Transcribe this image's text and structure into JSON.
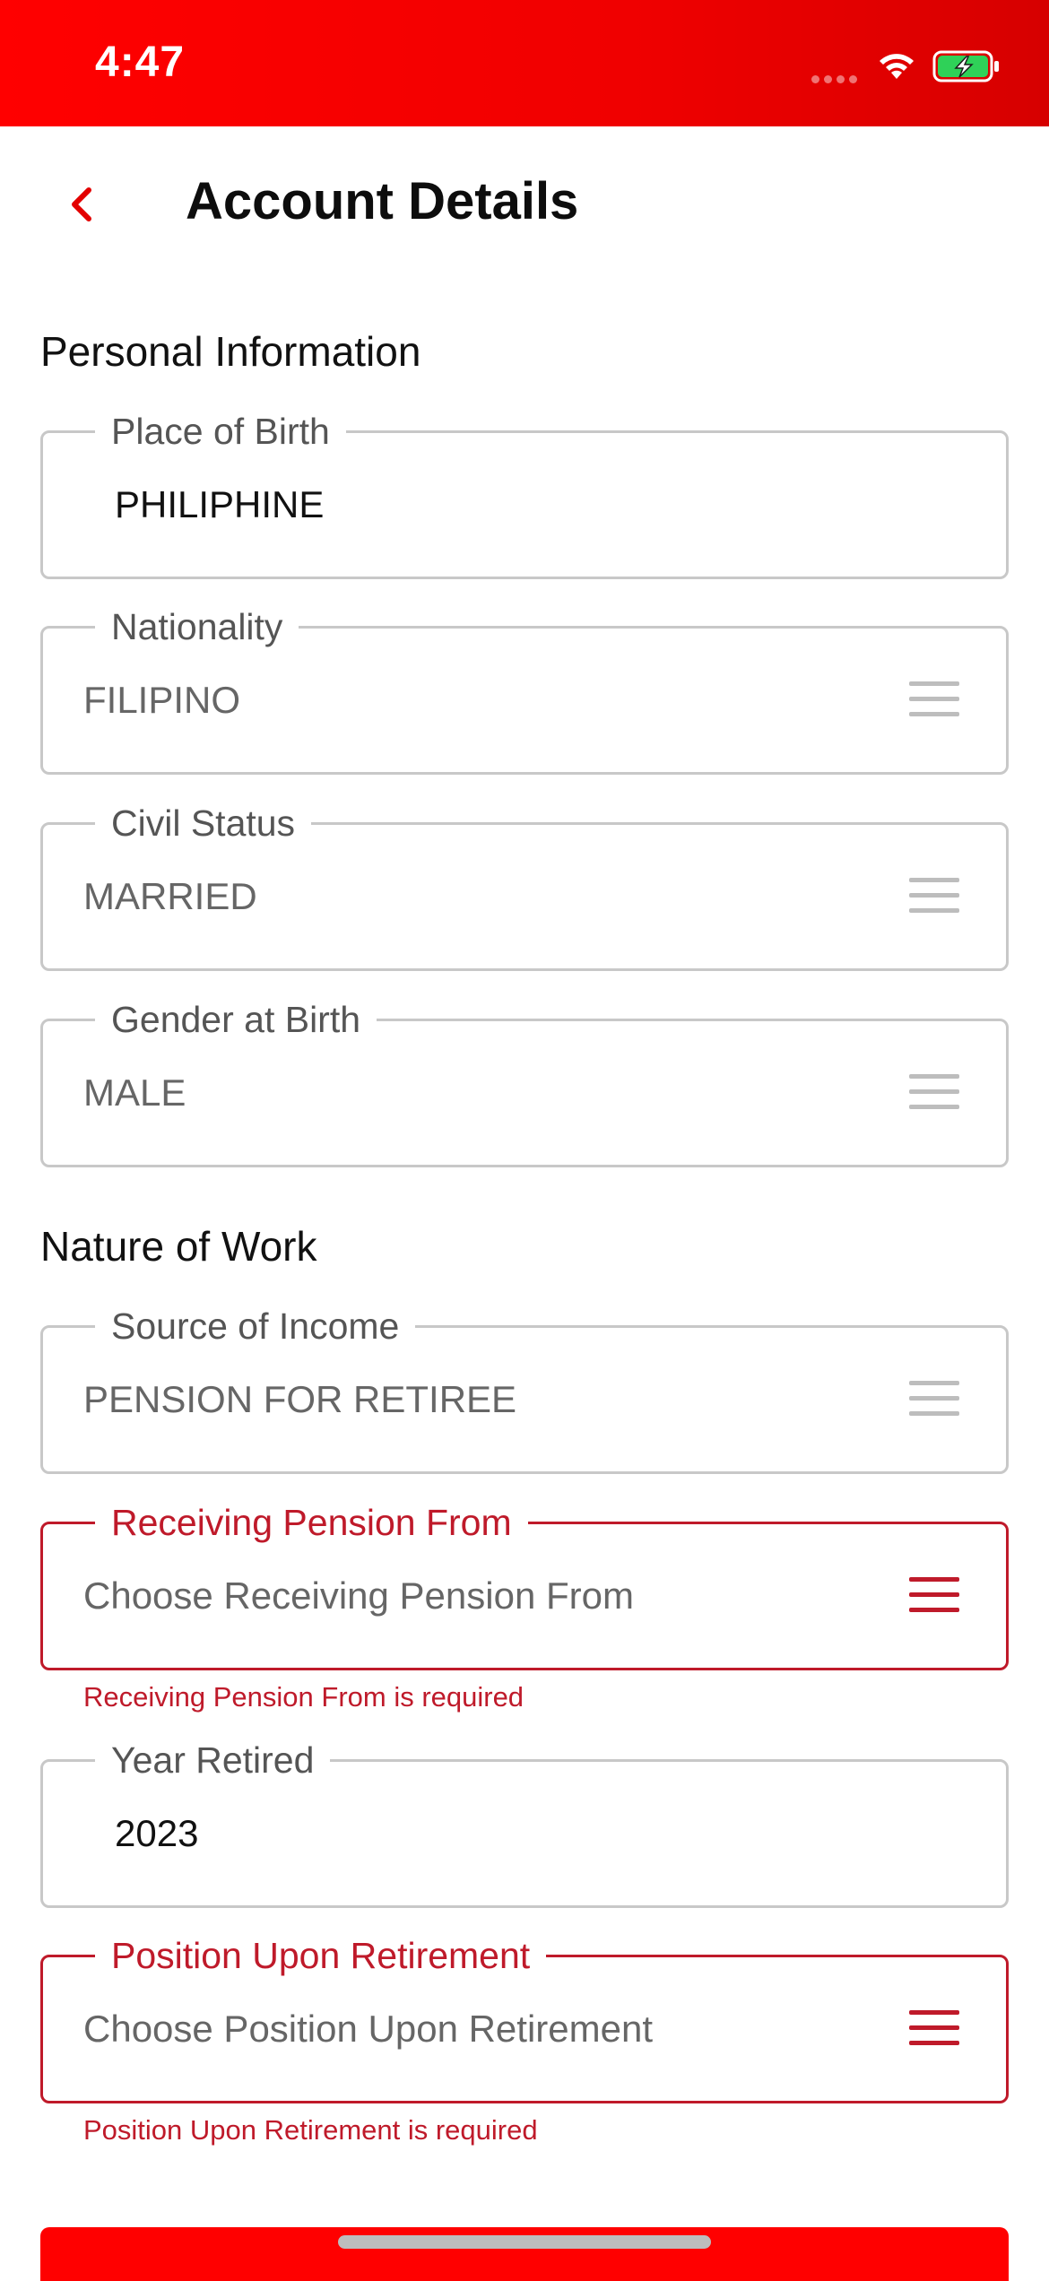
{
  "status_bar": {
    "time": "4:47"
  },
  "header": {
    "title": "Account Details"
  },
  "sections": {
    "personal": "Personal Information",
    "work": "Nature of Work"
  },
  "fields": {
    "place_of_birth": {
      "label": "Place of Birth",
      "value": "PHILIPHINE"
    },
    "nationality": {
      "label": "Nationality",
      "value": "FILIPINO"
    },
    "civil_status": {
      "label": "Civil Status",
      "value": "MARRIED"
    },
    "gender_at_birth": {
      "label": "Gender at Birth",
      "value": "MALE"
    },
    "source_of_income": {
      "label": "Source of Income",
      "value": "PENSION FOR RETIREE"
    },
    "receiving_pension_from": {
      "label": "Receiving Pension From",
      "placeholder": "Choose Receiving Pension From",
      "error": "Receiving Pension From is required"
    },
    "year_retired": {
      "label": "Year Retired",
      "value": "2023"
    },
    "position_upon_retirement": {
      "label": "Position Upon Retirement",
      "placeholder": "Choose Position Upon Retirement",
      "error": "Position Upon Retirement is required"
    }
  },
  "colors": {
    "brand_red": "#ff0000",
    "error_red": "#bf1a2a",
    "border_gray": "#c8c8c8"
  },
  "icons": {
    "back": "chevron-left-icon",
    "dropdown": "menu-lines-icon",
    "wifi": "wifi-icon",
    "battery": "battery-charging-icon"
  }
}
